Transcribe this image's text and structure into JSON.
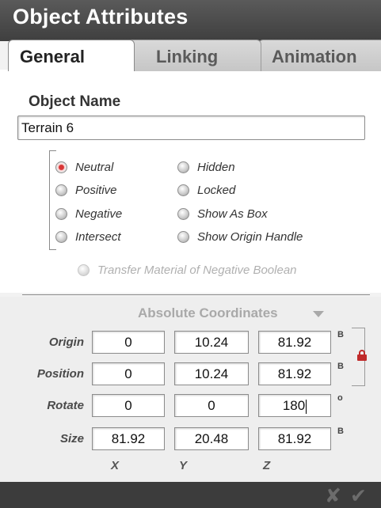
{
  "window": {
    "title": "Object Attributes"
  },
  "tabs": [
    {
      "label": "General",
      "active": true
    },
    {
      "label": "Linking",
      "active": false
    },
    {
      "label": "Animation",
      "active": false
    }
  ],
  "general": {
    "section_label": "Object Name",
    "object_name": "Terrain 6",
    "boolean_options": [
      {
        "label": "Neutral",
        "selected": true
      },
      {
        "label": "Positive",
        "selected": false
      },
      {
        "label": "Negative",
        "selected": false
      },
      {
        "label": "Intersect",
        "selected": false
      }
    ],
    "display_options": [
      {
        "label": "Hidden",
        "checked": false
      },
      {
        "label": "Locked",
        "checked": false
      },
      {
        "label": "Show As Box",
        "checked": false
      },
      {
        "label": "Show Origin Handle",
        "checked": false
      }
    ],
    "transfer_material": {
      "label": "Transfer Material of Negative Boolean",
      "enabled": false
    }
  },
  "coordinates": {
    "mode_label": "Absolute Coordinates",
    "rows": [
      {
        "label": "Origin",
        "x": "0",
        "y": "10.24",
        "z": "81.92",
        "unit": "B"
      },
      {
        "label": "Position",
        "x": "0",
        "y": "10.24",
        "z": "81.92",
        "unit": "B"
      },
      {
        "label": "Rotate",
        "x": "0",
        "y": "0",
        "z": "180",
        "unit": "o"
      },
      {
        "label": "Size",
        "x": "81.92",
        "y": "20.48",
        "z": "81.92",
        "unit": "B"
      }
    ],
    "axis_labels": [
      "X",
      "Y",
      "Z"
    ],
    "lock_color": "#c02a2a"
  },
  "footer": {
    "cancel_glyph": "✘",
    "ok_glyph": "✔"
  }
}
